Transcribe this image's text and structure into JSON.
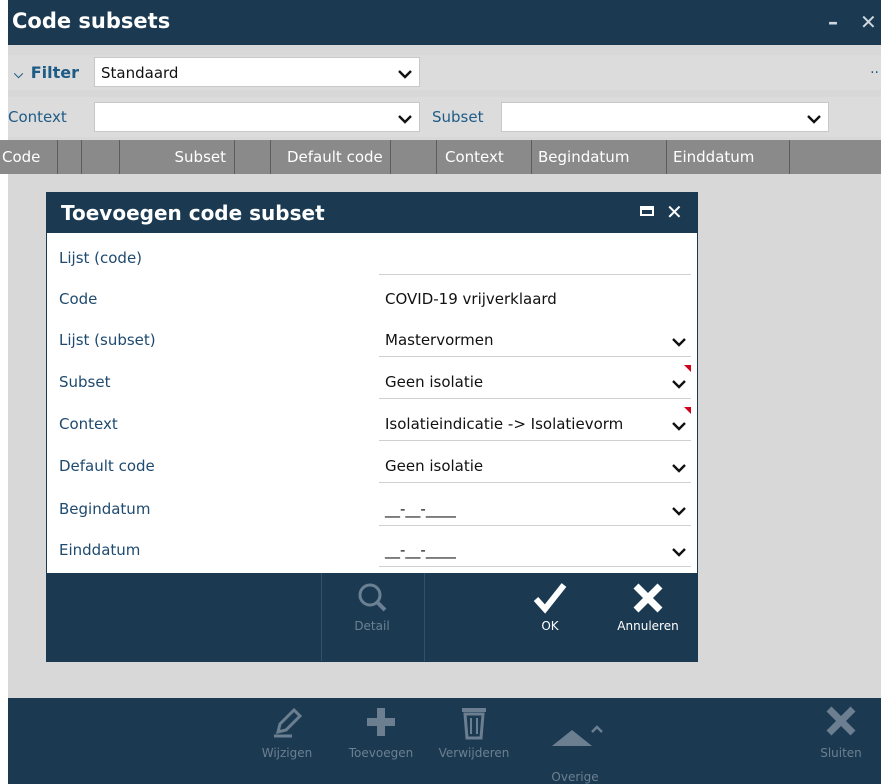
{
  "window": {
    "title": "Code subsets",
    "minimize_label": "–",
    "close_label": "✕"
  },
  "filter": {
    "toggle_label": "Filter",
    "selected": "Standaard",
    "more_label": ".."
  },
  "context_bar": {
    "context_label": "Context",
    "context_value": "",
    "subset_label": "Subset",
    "subset_value": ""
  },
  "columns": [
    "Code",
    "",
    "",
    "Subset",
    "",
    "Default code",
    "",
    "Context",
    "Begindatum",
    "Einddatum"
  ],
  "toolbar": {
    "buttons": [
      {
        "label": "Wijzigen",
        "icon": "pencil-icon"
      },
      {
        "label": "Toevoegen",
        "icon": "plus-icon"
      },
      {
        "label": "Verwijderen",
        "icon": "trash-icon"
      },
      {
        "label": "Overige\nacties",
        "icon": "arrow-up-icon"
      },
      {
        "label": "Sluiten",
        "icon": "close-icon"
      }
    ]
  },
  "modal": {
    "title": "Toevoegen code subset",
    "fields": [
      {
        "label": "Lijst (code)",
        "value": "",
        "dropdown": false
      },
      {
        "label": "Code",
        "value": "COVID-19 vrijverklaard",
        "dropdown": false
      },
      {
        "label": "Lijst (subset)",
        "value": "Mastervormen",
        "dropdown": true
      },
      {
        "label": "Subset",
        "value": "Geen isolatie",
        "dropdown": true,
        "required": true
      },
      {
        "label": "Context",
        "value": "Isolatieindicatie -> Isolatievorm",
        "dropdown": true,
        "required": true
      },
      {
        "label": "Default code",
        "value": "Geen isolatie",
        "dropdown": true
      },
      {
        "label": "Begindatum",
        "value": "__-__-____",
        "dropdown": true
      },
      {
        "label": "Einddatum",
        "value": "__-__-____",
        "dropdown": true
      }
    ],
    "footer": {
      "detail_label": "Detail",
      "ok_label": "OK",
      "cancel_label": "Annuleren"
    }
  },
  "colors": {
    "primary_dark": "#1b3a52",
    "label_blue": "#1e4a6f",
    "required_marker": "#d0021b"
  }
}
